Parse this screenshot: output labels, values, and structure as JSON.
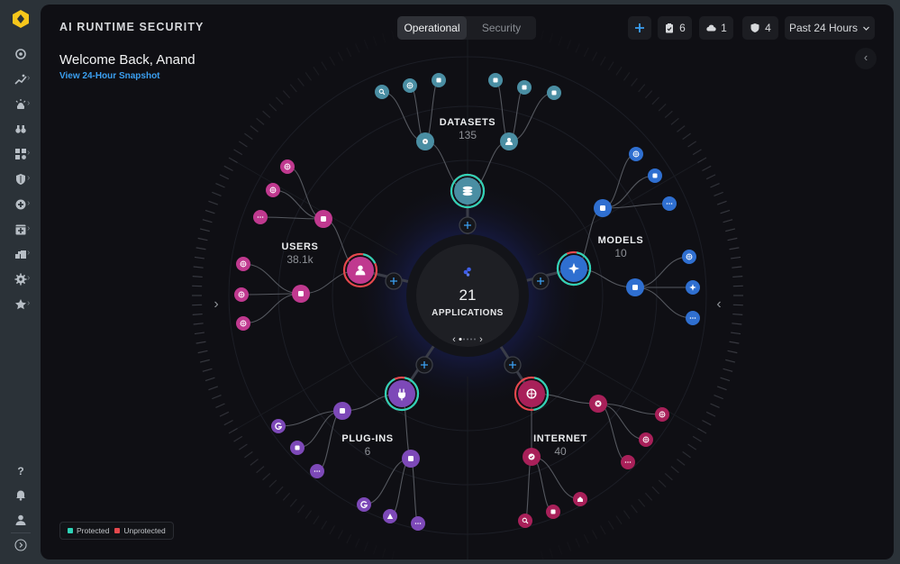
{
  "app": {
    "title": "AI RUNTIME SECURITY"
  },
  "tabs": [
    {
      "label": "Operational",
      "active": true
    },
    {
      "label": "Security",
      "active": false
    }
  ],
  "header": {
    "add_icon": "plus-icon",
    "badges": [
      {
        "icon": "clipboard-check-icon",
        "count": "6"
      },
      {
        "icon": "cloud-icon",
        "count": "1"
      },
      {
        "icon": "shield-icon",
        "count": "4"
      }
    ],
    "time_range": "Past 24 Hours"
  },
  "welcome": {
    "greeting": "Welcome Back, Anand",
    "snapshot_link": "View 24-Hour Snapshot"
  },
  "sidebar": {
    "items": [
      {
        "icon": "radar-icon",
        "has_submenu": false
      },
      {
        "icon": "trend-chart-icon",
        "has_submenu": true
      },
      {
        "icon": "alarm-siren-icon",
        "has_submenu": true
      },
      {
        "icon": "binoculars-icon",
        "has_submenu": false
      },
      {
        "icon": "widgets-icon",
        "has_submenu": true
      },
      {
        "icon": "half-shield-icon",
        "has_submenu": true
      },
      {
        "icon": "medical-plus-icon",
        "has_submenu": true
      },
      {
        "icon": "add-box-icon",
        "has_submenu": true
      },
      {
        "icon": "building-blocks-icon",
        "has_submenu": true
      },
      {
        "icon": "settings-icon",
        "has_submenu": true
      },
      {
        "icon": "star-icon",
        "has_submenu": true
      }
    ],
    "bottom": [
      {
        "icon": "help-icon"
      },
      {
        "icon": "bell-icon"
      },
      {
        "icon": "user-icon"
      },
      {
        "icon": "expand-icon"
      }
    ]
  },
  "center": {
    "count": "21",
    "label": "APPLICATIONS",
    "page": 1,
    "pages": 5
  },
  "colors": {
    "protected": "#2ed3b7",
    "unprotected": "#e5484d",
    "datasets": "#4a8ea3",
    "models": "#2f6fd0",
    "users": "#c0398f",
    "plugins": "#7d49b8",
    "internet": "#a82059",
    "accent_blue": "#3b9ff0"
  },
  "groups": [
    {
      "id": "datasets",
      "label": "DATASETS",
      "count": "135",
      "hub_icon": "database-icon",
      "protected": 1.0,
      "subs": [
        {
          "icon": "gear-icon",
          "leaves": [
            "search-analytics-icon",
            "network-globe-icon",
            "satellite-icon"
          ]
        },
        {
          "icon": "people-icon",
          "leaves": [
            "brackets-icon",
            "worm-icon",
            "chat-bubble-icon"
          ]
        }
      ]
    },
    {
      "id": "models",
      "label": "MODELS",
      "count": "10",
      "hub_icon": "sparkles-icon",
      "protected": 0.9,
      "subs": [
        {
          "icon": "sliders-icon",
          "leaves": [
            "openai-icon",
            "palm-icon",
            "more-icon"
          ]
        },
        {
          "icon": "blocks-icon",
          "leaves": [
            "hexagon-icon",
            "star-four-icon",
            "more-icon"
          ]
        }
      ]
    },
    {
      "id": "users",
      "label": "USERS",
      "count": "38.1k",
      "hub_icon": "person-icon",
      "protected": 0.15,
      "subs": [
        {
          "icon": "building-icon",
          "leaves": [
            "network-icon",
            "network-icon",
            "more-icon"
          ]
        },
        {
          "icon": "robot-icon",
          "leaves": [
            "globe-icon",
            "globe-icon",
            "globe-icon"
          ]
        }
      ]
    },
    {
      "id": "plugins",
      "label": "PLUG-INS",
      "count": "6",
      "hub_icon": "plug-icon",
      "protected": 0.9,
      "subs": [
        {
          "icon": "dots-cluster-icon",
          "leaves": [
            "google-icon",
            "aws-icon",
            "more-icon"
          ]
        },
        {
          "icon": "file-icon",
          "leaves": [
            "google-icon",
            "atlassian-icon",
            "more-icon"
          ]
        }
      ]
    },
    {
      "id": "internet",
      "label": "INTERNET",
      "count": "40",
      "hub_icon": "globe-icon",
      "protected": 0.45,
      "subs": [
        {
          "icon": "close-circle-icon",
          "leaves": [
            "network-icon",
            "network-icon",
            "more-icon"
          ]
        },
        {
          "icon": "check-circle-icon",
          "leaves": [
            "search-icon",
            "monitor-icon",
            "home-icon"
          ]
        }
      ]
    }
  ],
  "legend": {
    "protected": "Protected",
    "unprotected": "Unprotected"
  }
}
